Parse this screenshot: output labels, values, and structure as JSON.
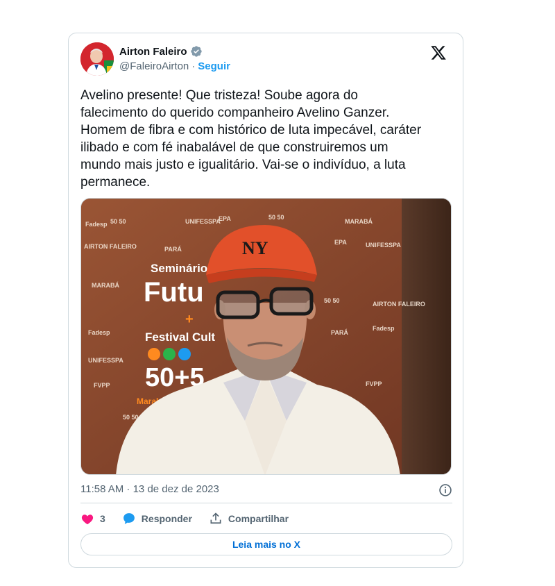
{
  "author": {
    "name": "Airton Faleiro",
    "handle": "@FaleiroAirton",
    "separator": "·",
    "follow_label": "Seguir",
    "verified": true,
    "avatar_icon": "profile-photo"
  },
  "tweet": {
    "text": "Avelino presente! Que tristeza! Soube agora do\nfalecimento do querido companheiro Avelino Ganzer.\nHomem de fibra e com histórico de luta impecável, caráter\nilibado e com fé inabalável de que construiremos um\nmundo mais justo e igualitário. Vai-se o indivíduo, a luta\npermanece.",
    "timestamp": "11:58 AM · 13 de dez de 2023"
  },
  "media": {
    "banner_title_1": "Seminário",
    "banner_title_2": "Futu",
    "banner_plus": "+",
    "banner_title_3": "Festival Cult",
    "banner_number": "50+5",
    "banner_city": "Marabá - 2",
    "cap_logo": "NY",
    "logos": [
      "50 50",
      "UNIFESSPA",
      "EPA",
      "Fadesp",
      "MARABÁ",
      "PARÁ",
      "FVPP",
      "AIRTON FALEIRO",
      "50 50",
      "EPA",
      "UNIFESSPA",
      "Fadesp",
      "PARÁ",
      "FVPP"
    ]
  },
  "actions": {
    "like_count": "3",
    "reply_label": "Responder",
    "share_label": "Compartilhar"
  },
  "read_more_label": "Leia mais no X",
  "colors": {
    "accent": "#1d9bf0",
    "like": "#f91880",
    "text": "#0f1419",
    "muted": "#536471"
  }
}
